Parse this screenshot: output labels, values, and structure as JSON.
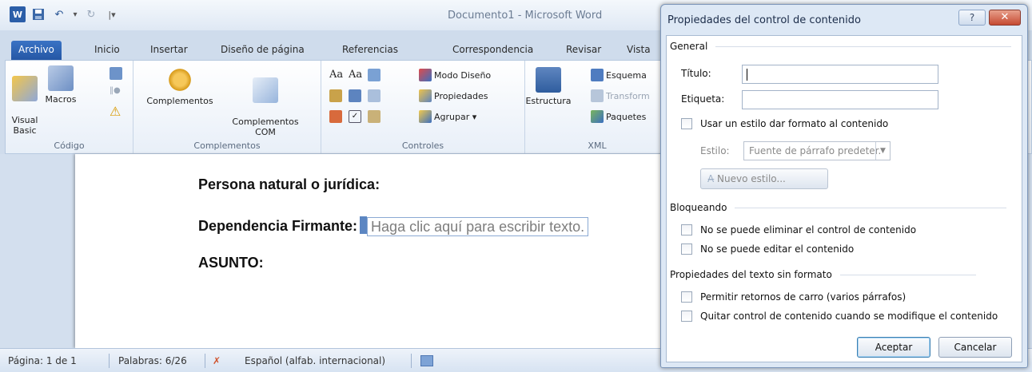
{
  "word": {
    "window_title": "Documento1 - Microsoft Word",
    "quick_access": {
      "logo": "W",
      "save_icon": "save-icon",
      "undo_icon": "↶",
      "dropdown": "▾",
      "redo_icon": "↻",
      "customize": "|▾"
    },
    "tabs": [
      "Archivo",
      "Inicio",
      "Insertar",
      "Diseño de página",
      "Referencias",
      "Correspondencia",
      "Revisar",
      "Vista"
    ],
    "ribbon": {
      "codigo": {
        "label": "Código",
        "visual_basic": "Visual\nBasic",
        "macros": "Macros"
      },
      "complementos": {
        "label": "Complementos",
        "complementos": "Complementos",
        "complementos_com": "Complementos\nCOM"
      },
      "controles": {
        "label": "Controles",
        "aa1": "Aa",
        "aa2": "Aa",
        "modo_diseno": "Modo Diseño",
        "propiedades": "Propiedades",
        "agrupar": "Agrupar ▾"
      },
      "xml": {
        "label": "XML",
        "estructura": "Estructura",
        "esquema": "Esquema",
        "transform": "Transform",
        "paquetes": "Paquetes"
      }
    },
    "document": {
      "line1": "Persona natural o jurídica:",
      "line2_label": "Dependencia Firmante:",
      "line2_placeholder": "Haga clic aquí para escribir texto.",
      "line3": "ASUNTO:"
    },
    "status": {
      "page": "Página: 1 de 1",
      "words": "Palabras: 6/26",
      "language": "Español (alfab. internacional)"
    }
  },
  "dialog": {
    "title": "Propiedades del control de contenido",
    "help": "?",
    "close": "✕",
    "general": {
      "heading": "General",
      "titulo_label": "Título:",
      "titulo_value": "",
      "etiqueta_label": "Etiqueta:",
      "etiqueta_value": "",
      "usar_estilo": "Usar un estilo dar formato al contenido",
      "estilo_label": "Estilo:",
      "estilo_value": "Fuente de párrafo predeter.",
      "nuevo_estilo": "Nuevo estilo..."
    },
    "bloqueando": {
      "heading": "Bloqueando",
      "no_eliminar": "No se puede eliminar el control de contenido",
      "no_editar": "No se puede editar el contenido"
    },
    "texto": {
      "heading": "Propiedades del texto sin formato",
      "retornos": "Permitir retornos de carro (varios párrafos)",
      "quitar": "Quitar control de contenido cuando se modifique el contenido"
    },
    "buttons": {
      "aceptar": "Aceptar",
      "cancelar": "Cancelar"
    }
  }
}
